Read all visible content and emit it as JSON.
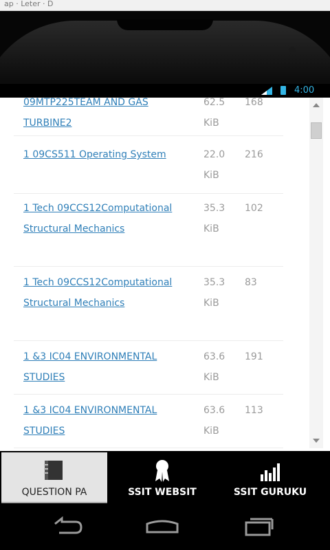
{
  "browser": {
    "partial_text": "ap · Leter · D"
  },
  "status_bar": {
    "time": "4:00"
  },
  "files": [
    {
      "title": "09MTP225TEAM AND GAS TURBINE2",
      "size": "62.5 KiB",
      "count": "168"
    },
    {
      "title": "1 09CS511 Operating System",
      "size": "22.0 KiB",
      "count": "216"
    },
    {
      "title": "1 Tech 09CCS12Computational Structural Mechanics",
      "size": "35.3 KiB",
      "count": "102"
    },
    {
      "title": "1 Tech 09CCS12Computational Structural Mechanics",
      "size": "35.3 KiB",
      "count": "83"
    },
    {
      "title": "1 &3 IC04 ENVIRONMENTAL STUDIES",
      "size": "63.6 KiB",
      "count": "191"
    },
    {
      "title": "1 &3 IC04 ENVIRONMENTAL STUDIES",
      "size": "63.6 KiB",
      "count": "113"
    }
  ],
  "tabs": [
    {
      "label": "QUESTION PA",
      "icon": "book-icon",
      "active": true
    },
    {
      "label": "SSIT WEBSIT",
      "icon": "award-ribbon-icon",
      "active": false
    },
    {
      "label": "SSIT GURUKU",
      "icon": "bar-chart-icon",
      "active": false
    }
  ],
  "nav": {
    "back": "back-icon",
    "home": "home-icon",
    "recent": "recent-apps-icon"
  },
  "colors": {
    "link": "#2f7fb8",
    "accent": "#33b5e5",
    "active_tab": "#e4e4e4"
  }
}
